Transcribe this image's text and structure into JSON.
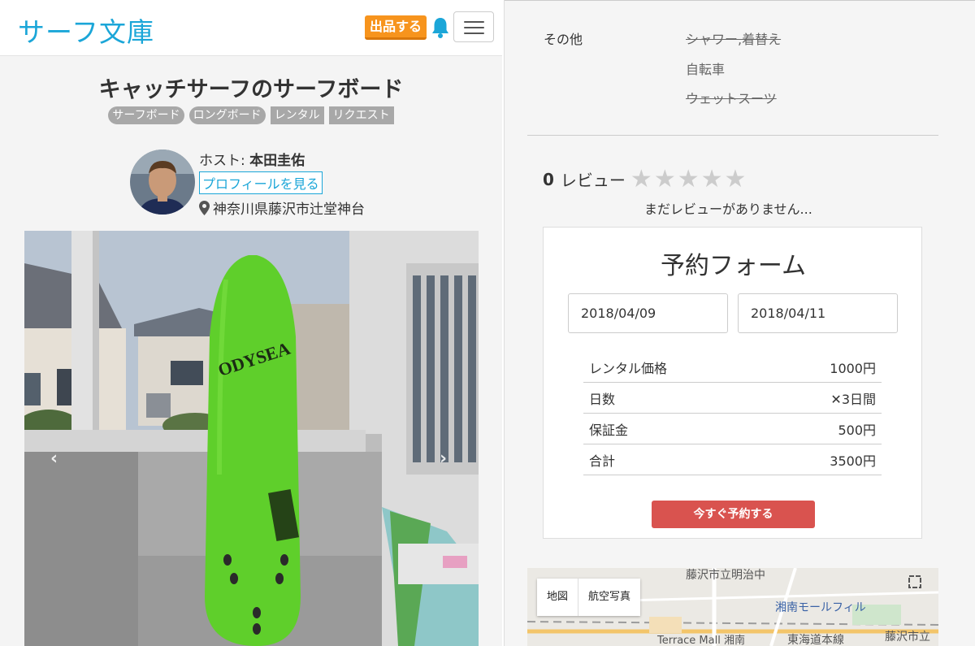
{
  "navbar": {
    "brand": "サーフ文庫",
    "list_button": "出品する"
  },
  "listing": {
    "title": "キャッチサーフのサーフボード",
    "tags": [
      "サーフボード",
      "ロングボード",
      "レンタル",
      "リクエスト"
    ],
    "host_label": "ホスト: ",
    "host_name": "本田圭佑",
    "profile_link": "プロフィールを見る",
    "location": "神奈川県藤沢市辻堂神台",
    "board_brand": "ODYSEA"
  },
  "amenities": {
    "label": "その他",
    "items": [
      {
        "text": "シャワー,着替え",
        "available": false
      },
      {
        "text": "自転車",
        "available": true
      },
      {
        "text": "ウェットスーツ",
        "available": false
      }
    ]
  },
  "reviews": {
    "count": "0",
    "label": "レビュー",
    "rating": 0,
    "empty_text": "まだレビューがありません..."
  },
  "reservation": {
    "title": "予約フォーム",
    "start_date": "2018/04/09",
    "end_date": "2018/04/11",
    "rows": [
      {
        "label": "レンタル価格",
        "value": "1000円"
      },
      {
        "label": "日数",
        "value": "✕3日間"
      },
      {
        "label": "保証金",
        "value": "500円"
      },
      {
        "label": "合計",
        "value": "3500円"
      }
    ],
    "submit_label": "今すぐ予約する"
  },
  "map": {
    "tabs": [
      "地図",
      "航空写真"
    ],
    "labels": [
      "藤沢市立明治中",
      "湘南モールフィル",
      "Terrace Mall 湘南",
      "東海道本線",
      "藤沢市立"
    ]
  },
  "colors": {
    "brand": "#1ba6d8",
    "list_button": "#f7941d",
    "reserve_button": "#d9534f",
    "tag": "#a8a8a8"
  }
}
